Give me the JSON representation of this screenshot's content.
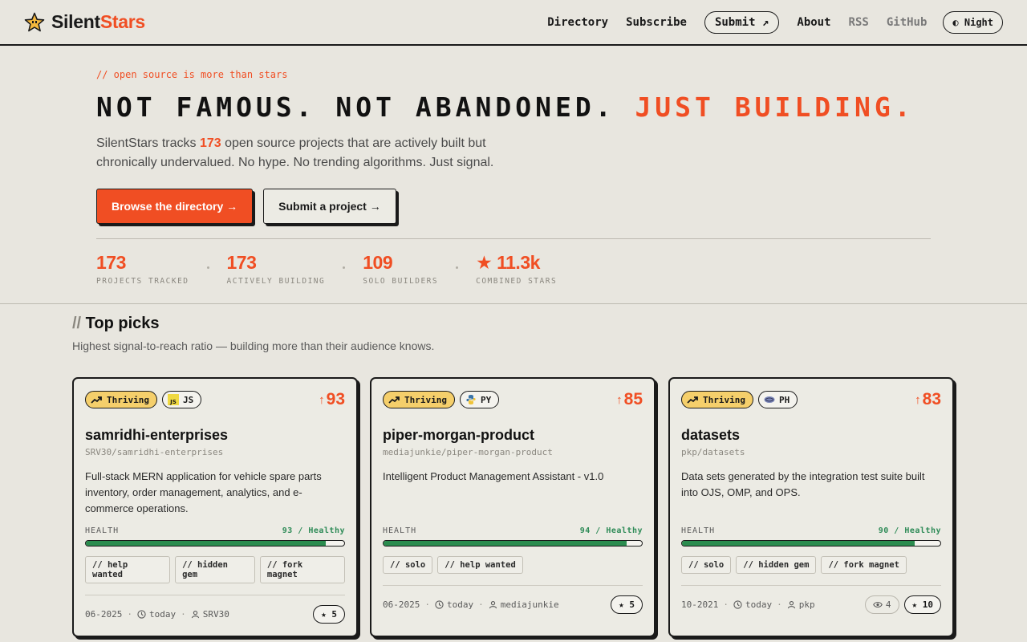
{
  "header": {
    "brand_left": "Silent",
    "brand_right": "Stars",
    "nav": {
      "directory": "Directory",
      "subscribe": "Subscribe",
      "submit": "Submit ↗",
      "about": "About",
      "rss": "RSS",
      "github": "GitHub",
      "night": "◐ Night"
    }
  },
  "hero": {
    "eyebrow": "// open source is more than stars",
    "headline_main": "Not famous. Not abandoned. ",
    "headline_accent": "Just building.",
    "lede_before": "SilentStars tracks ",
    "lede_count": "173",
    "lede_after": " open source projects that are actively built but chronically undervalued. No hype. No trending algorithms. Just signal.",
    "cta_primary": "Browse the directory →",
    "cta_secondary": "Submit a project →"
  },
  "stats": [
    {
      "value": "173",
      "label": "PROJECTS TRACKED"
    },
    {
      "value": "173",
      "label": "ACTIVELY BUILDING"
    },
    {
      "value": "109",
      "label": "SOLO BUILDERS"
    },
    {
      "value": "★ 11.3k",
      "label": "COMBINED STARS"
    }
  ],
  "section": {
    "slash": "//",
    "title": " Top picks",
    "subtitle": "Highest signal-to-reach ratio — building more than their audience knows."
  },
  "cards": [
    {
      "status": "Thriving",
      "lang": "JS",
      "score": "93",
      "title": "samridhi-enterprises",
      "repo": "SRV30/samridhi-enterprises",
      "desc": "Full-stack MERN application for vehicle spare parts inventory, order management, analytics, and e-commerce operations.",
      "health_label": "HEALTH",
      "health_text": "93 / Healthy",
      "health": 93,
      "tags": [
        "// help wanted",
        "// hidden gem",
        "// fork magnet"
      ],
      "date": "06-2025",
      "updated": "today",
      "owner": "SRV30",
      "stars": "★ 5"
    },
    {
      "status": "Thriving",
      "lang": "PY",
      "score": "85",
      "title": "piper-morgan-product",
      "repo": "mediajunkie/piper-morgan-product",
      "desc": "Intelligent Product Management Assistant - v1.0",
      "health_label": "HEALTH",
      "health_text": "94 / Healthy",
      "health": 94,
      "tags": [
        "// solo",
        "// help wanted"
      ],
      "date": "06-2025",
      "updated": "today",
      "owner": "mediajunkie",
      "stars": "★ 5"
    },
    {
      "status": "Thriving",
      "lang": "PH",
      "score": "83",
      "title": "datasets",
      "repo": "pkp/datasets",
      "desc": "Data sets generated by the integration test suite built into OJS, OMP, and OPS.",
      "health_label": "HEALTH",
      "health_text": "90 / Healthy",
      "health": 90,
      "tags": [
        "// solo",
        "// hidden gem",
        "// fork magnet"
      ],
      "date": "10-2021",
      "updated": "today",
      "owner": "pkp",
      "watchers": "4",
      "stars": "★ 10"
    }
  ]
}
